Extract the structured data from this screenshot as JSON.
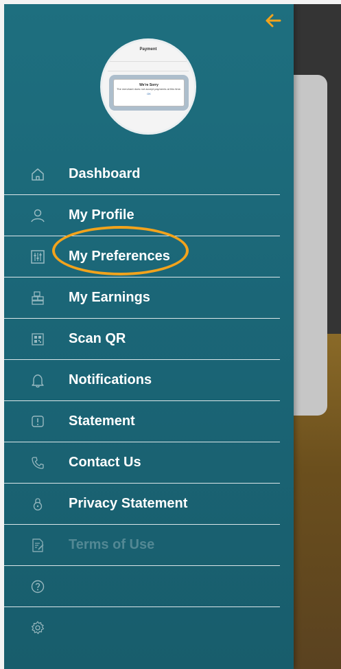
{
  "colors": {
    "drawer": "#1b6677",
    "accent": "#f2a31c",
    "text": "#ffffff"
  },
  "header": {
    "back_icon": "arrow-left-icon"
  },
  "profile": {
    "avatar_icon": "profile-photo",
    "photo_title": "Payment",
    "photo_dialog_title": "We're Sorry",
    "photo_dialog_message": "The merchant does not accept payments at this time.",
    "photo_dialog_button": "OK"
  },
  "menu": {
    "items": [
      {
        "label": "Dashboard",
        "icon": "home-icon"
      },
      {
        "label": "My Profile",
        "icon": "user-icon"
      },
      {
        "label": "My Preferences",
        "icon": "sliders-icon"
      },
      {
        "label": "My Earnings",
        "icon": "earnings-icon"
      },
      {
        "label": "Scan QR",
        "icon": "qr-icon"
      },
      {
        "label": "Notifications",
        "icon": "bell-icon"
      },
      {
        "label": "Statement",
        "icon": "statement-icon"
      },
      {
        "label": "Contact Us",
        "icon": "phone-icon"
      },
      {
        "label": "Privacy Statement",
        "icon": "lock-icon"
      },
      {
        "label": "Terms of Use",
        "icon": "document-edit-icon"
      },
      {
        "label": "",
        "icon": "help-icon"
      },
      {
        "label": "",
        "icon": "gear-icon"
      }
    ]
  }
}
